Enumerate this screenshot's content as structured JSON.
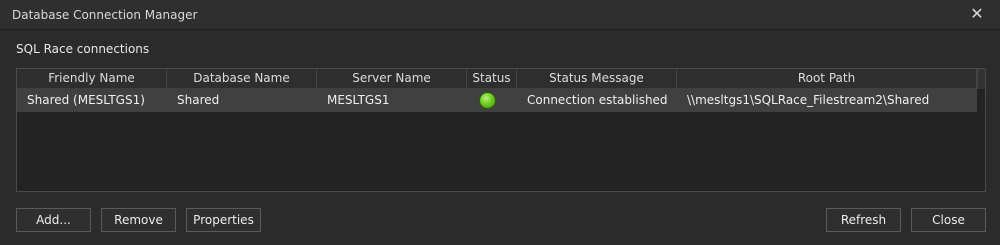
{
  "window": {
    "title": "Database Connection Manager",
    "close_glyph": "✕"
  },
  "section": {
    "label": "SQL Race connections"
  },
  "grid": {
    "columns": [
      "Friendly Name",
      "Database Name",
      "Server Name",
      "Status",
      "Status Message",
      "Root Path"
    ],
    "rows": [
      {
        "friendly_name": "Shared (MESLTGS1)",
        "database_name": "Shared",
        "server_name": "MESLTGS1",
        "status_icon": "status-connected-icon",
        "status_color": "#6fcb22",
        "status_message": "Connection established",
        "root_path": "\\\\mesltgs1\\SQLRace_Filestream2\\Shared"
      }
    ]
  },
  "buttons": {
    "add": "Add...",
    "remove": "Remove",
    "properties": "Properties",
    "refresh": "Refresh",
    "close": "Close"
  },
  "colors": {
    "background": "#2b2b2b",
    "selected_row": "#404040",
    "status_ok": "#6fcb22"
  }
}
